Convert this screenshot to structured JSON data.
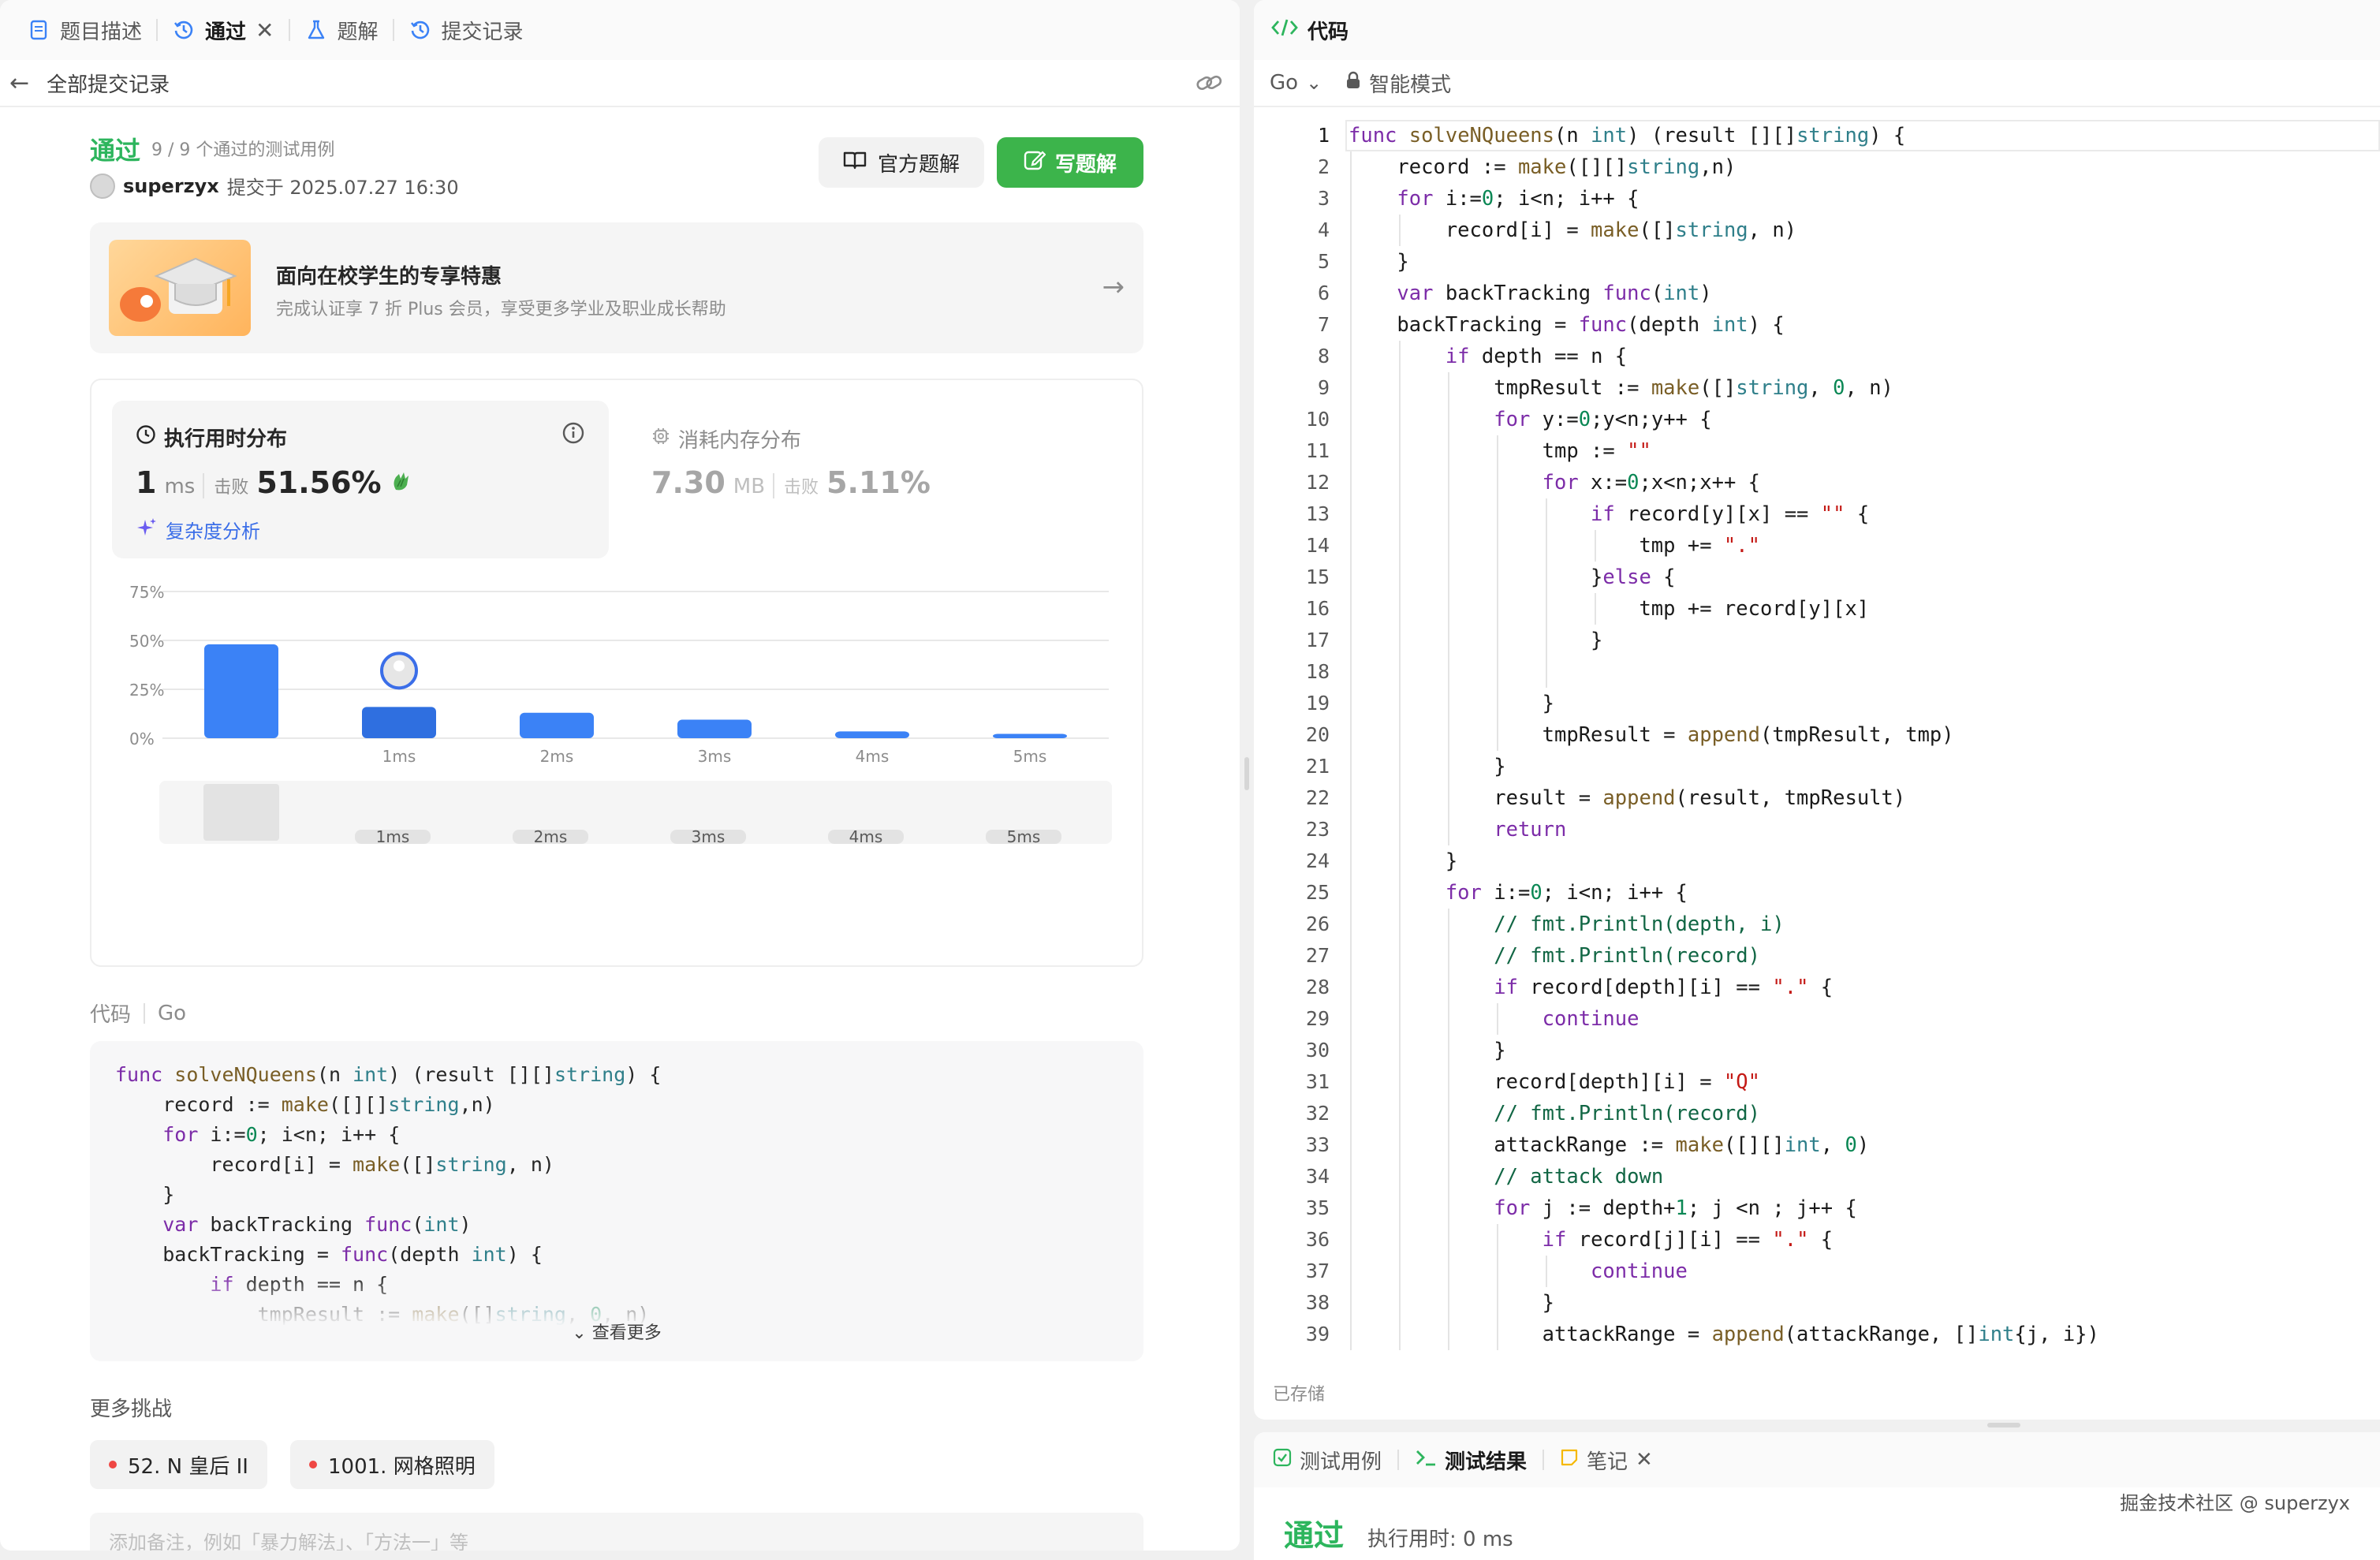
{
  "left_tabs": [
    {
      "label": "题目描述",
      "icon": "document-icon"
    },
    {
      "label": "通过",
      "icon": "history-icon"
    },
    {
      "label": "题解",
      "icon": "flask-icon"
    },
    {
      "label": "提交记录",
      "icon": "history-icon"
    }
  ],
  "back_label": "全部提交记录",
  "submission": {
    "status": "通过",
    "cases": "9 / 9 个通过的测试用例",
    "author": "superzyx",
    "submitted_at": "提交于 2025.07.27 16:30"
  },
  "buttons": {
    "official": "官方题解",
    "write": "写题解"
  },
  "promo": {
    "title": "面向在校学生的专享特惠",
    "subtitle": "完成认证享 7 折 Plus 会员，享受更多学业及职业成长帮助"
  },
  "runtime": {
    "title": "执行用时分布",
    "value": "1",
    "unit": "ms",
    "beats_label": "击败",
    "beats": "51.56%",
    "complexity": "复杂度分析"
  },
  "memory": {
    "title": "消耗内存分布",
    "value": "7.30",
    "unit": "MB",
    "beats_label": "击败",
    "beats": "5.11%"
  },
  "chart_data": {
    "type": "bar",
    "categories": [
      "",
      "1ms",
      "2ms",
      "3ms",
      "4ms",
      "5ms"
    ],
    "values": [
      48,
      16,
      13,
      9.5,
      3.5,
      2.2
    ],
    "ylim": [
      0,
      75
    ],
    "yticks": [
      0,
      25,
      50,
      75
    ],
    "ytick_labels": [
      "0%",
      "25%",
      "50%",
      "75%"
    ],
    "highlight_index": 1,
    "grid": true,
    "colors": {
      "bar": "#3b82f6",
      "bar_highlight": "#2f6fe0",
      "grid": "#e8e8e8"
    },
    "brush_labels": [
      "1ms",
      "2ms",
      "3ms",
      "4ms",
      "5ms"
    ]
  },
  "code_section": {
    "label": "代码",
    "lang": "Go",
    "see_more": "查看更多"
  },
  "preview_lines": [
    "func solveNQueens(n int) (result [][]string) {",
    "    record := make([][]string,n)",
    "    for i:=0; i<n; i++ {",
    "        record[i] = make([]string, n)",
    "    }",
    "    var backTracking func(int)",
    "    backTracking = func(depth int) {",
    "        if depth == n {",
    "            tmpResult := make([]string, 0, n)"
  ],
  "more_challenges": {
    "title": "更多挑战",
    "items": [
      "52. N 皇后 II",
      "1001. 网格照明"
    ]
  },
  "note_placeholder": "添加备注，例如「暴力解法」、「方法一」等",
  "editor": {
    "tab": "代码",
    "lang": "Go",
    "mode": "智能模式",
    "saved": "已存储"
  },
  "code_lines": [
    "func solveNQueens(n int) (result [][]string) {",
    "    record := make([][]string,n)",
    "    for i:=0; i<n; i++ {",
    "        record[i] = make([]string, n)",
    "    }",
    "    var backTracking func(int)",
    "    backTracking = func(depth int) {",
    "        if depth == n {",
    "            tmpResult := make([]string, 0, n)",
    "            for y:=0;y<n;y++ {",
    "                tmp := \"\"",
    "                for x:=0;x<n;x++ {",
    "                    if record[y][x] == \"\" {",
    "                        tmp += \".\"",
    "                    }else {",
    "                        tmp += record[y][x]",
    "                    }",
    "",
    "                }",
    "                tmpResult = append(tmpResult, tmp)",
    "            }",
    "            result = append(result, tmpResult)",
    "            return",
    "        }",
    "        for i:=0; i<n; i++ {",
    "            // fmt.Println(depth, i)",
    "            // fmt.Println(record)",
    "            if record[depth][i] == \".\" {",
    "                continue",
    "            }",
    "            record[depth][i] = \"Q\"",
    "            // fmt.Println(record)",
    "            attackRange := make([][]int, 0)",
    "            // attack down",
    "            for j := depth+1; j <n ; j++ {",
    "                if record[j][i] == \".\" {",
    "                    continue",
    "                }",
    "                attackRange = append(attackRange, []int{j, i})"
  ],
  "bottom_tabs": [
    "测试用例",
    "测试结果",
    "笔记"
  ],
  "result": {
    "status": "通过",
    "time": "执行用时: 0 ms"
  },
  "watermark": "掘金技术社区 @ superzyx"
}
